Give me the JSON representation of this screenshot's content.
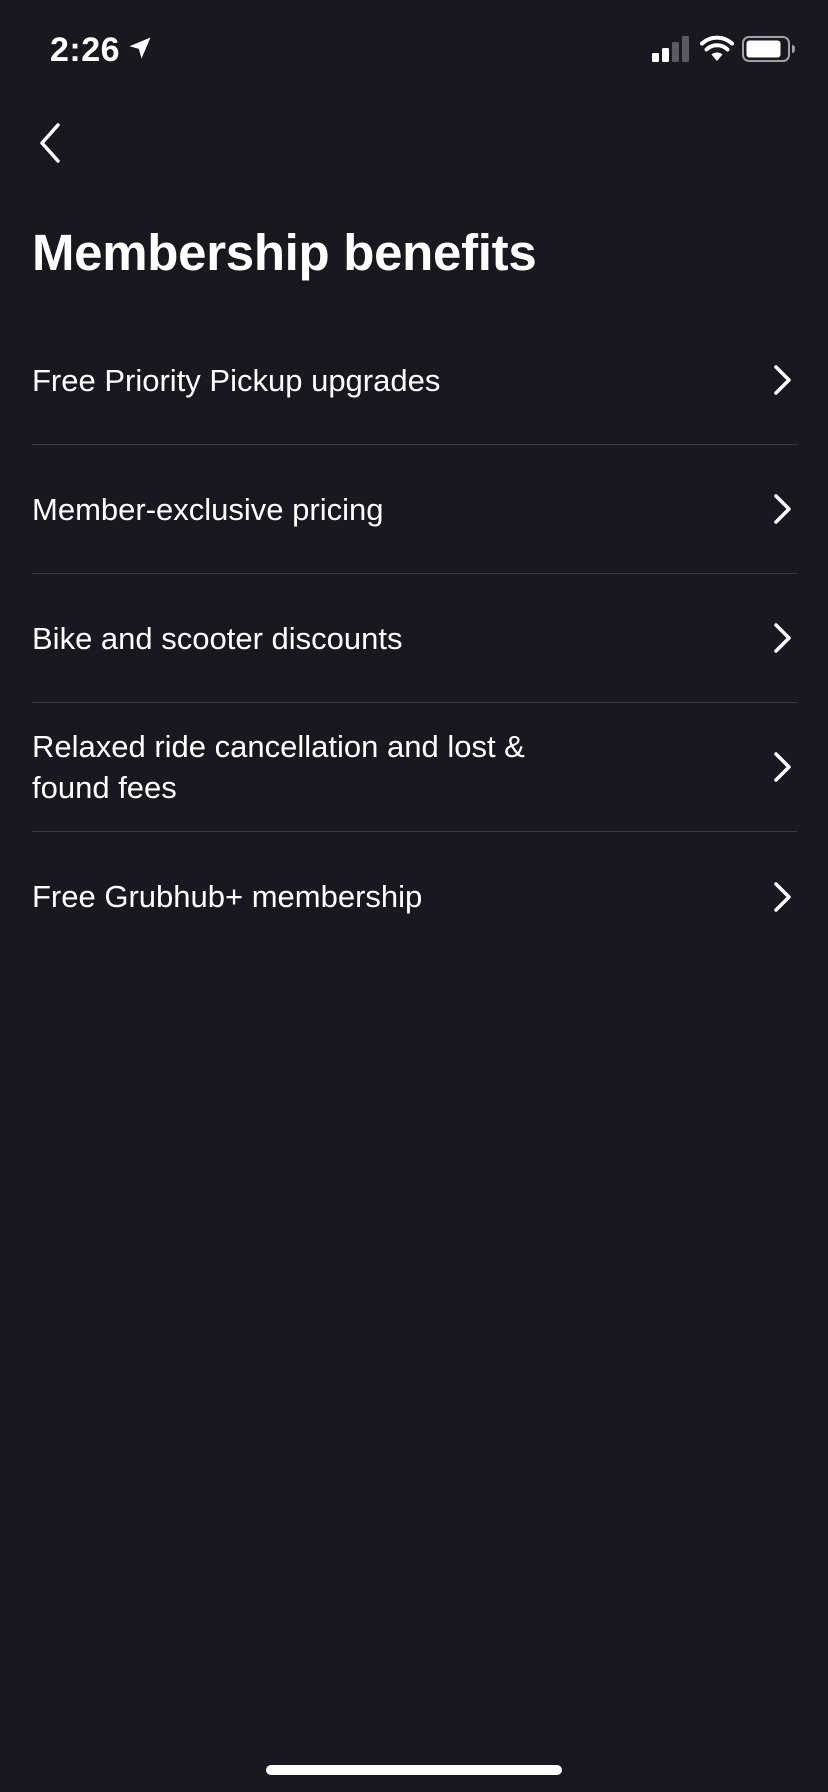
{
  "status_bar": {
    "time": "2:26",
    "icons": [
      "location-arrow-icon",
      "cellular-signal-icon",
      "wifi-icon",
      "battery-icon"
    ]
  },
  "nav": {
    "back_icon": "chevron-left-icon"
  },
  "page": {
    "title": "Membership benefits"
  },
  "benefits": [
    {
      "label": "Free Priority Pickup upgrades"
    },
    {
      "label": "Member-exclusive pricing"
    },
    {
      "label": "Bike and scooter discounts"
    },
    {
      "label": "Relaxed ride cancellation and lost & found fees"
    },
    {
      "label": "Free Grubhub+ membership"
    }
  ],
  "colors": {
    "background": "#181820",
    "text": "#ffffff",
    "divider": "#3a3a44"
  }
}
